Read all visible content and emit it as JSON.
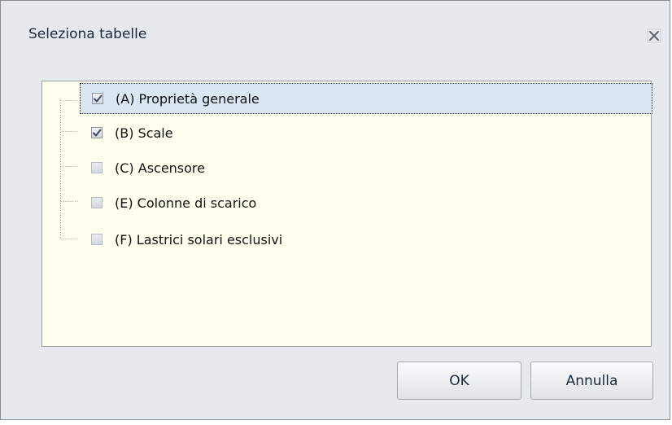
{
  "dialog": {
    "title": "Seleziona tabelle",
    "close_icon": "close-icon"
  },
  "tree": {
    "items": [
      {
        "label": "(A) Proprietà generale",
        "checked": true,
        "selected": true
      },
      {
        "label": "(B) Scale",
        "checked": true,
        "selected": false
      },
      {
        "label": "(C) Ascensore",
        "checked": false,
        "selected": false
      },
      {
        "label": "(E) Colonne di scarico",
        "checked": false,
        "selected": false
      },
      {
        "label": "(F) Lastrici solari esclusivi",
        "checked": false,
        "selected": false
      }
    ]
  },
  "buttons": {
    "ok_label": "OK",
    "cancel_label": "Annulla"
  },
  "colors": {
    "panel_background": "#fffff0",
    "selection": "#dbe7f5",
    "dialog_background": "#e6eaef"
  }
}
